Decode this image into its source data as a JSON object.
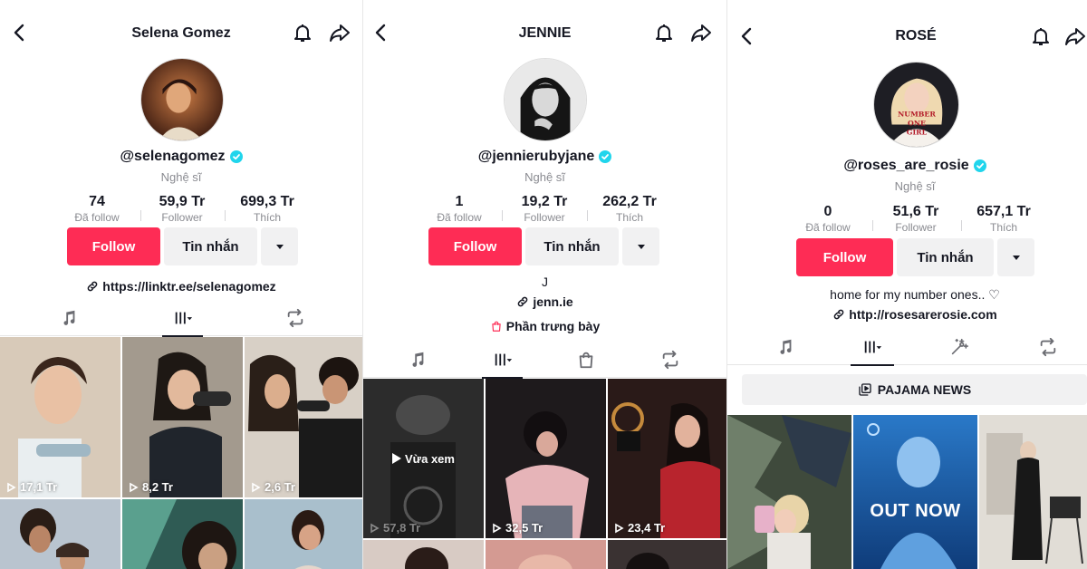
{
  "profiles": [
    {
      "name": "Selena Gomez",
      "handle": "@selenagomez",
      "subtitle": "Nghệ sĩ",
      "stats": [
        {
          "value": "74",
          "label": "Đã follow"
        },
        {
          "value": "59,9 Tr",
          "label": "Follower"
        },
        {
          "value": "699,3 Tr",
          "label": "Thích"
        }
      ],
      "follow_label": "Follow",
      "message_label": "Tin nhắn",
      "link": "https://linktr.ee/selenagomez",
      "videos": [
        {
          "views": "17,1 Tr",
          "color": "#c9b8a6"
        },
        {
          "views": "8,2 Tr",
          "color": "#8a8176"
        },
        {
          "views": "2,6 Tr",
          "color": "#6f6055"
        },
        {
          "views": "",
          "color": "#7b8aa0"
        },
        {
          "views": "",
          "color": "#3f6f66"
        },
        {
          "views": "",
          "color": "#8fa7b8"
        }
      ]
    },
    {
      "name": "JENNIE",
      "handle": "@jennierubyjane",
      "subtitle": "Nghệ sĩ",
      "stats": [
        {
          "value": "1",
          "label": "Đã follow"
        },
        {
          "value": "19,2 Tr",
          "label": "Follower"
        },
        {
          "value": "262,2 Tr",
          "label": "Thích"
        }
      ],
      "follow_label": "Follow",
      "message_label": "Tin nhắn",
      "bio": "J",
      "link": "jenn.ie",
      "showcase": "Phần trưng bày",
      "videos": [
        {
          "views": "57,8 Tr",
          "color": "#2a2a2a",
          "overlay": "Vừa xem"
        },
        {
          "views": "32,5 Tr",
          "color": "#3b2f33"
        },
        {
          "views": "23,4 Tr",
          "color": "#5a2226"
        },
        {
          "views": "",
          "color": "#b9a49a"
        },
        {
          "views": "",
          "color": "#c48a86"
        },
        {
          "views": "",
          "color": "#4b4040"
        }
      ]
    },
    {
      "name": "ROSÉ",
      "handle": "@roses_are_rosie",
      "subtitle": "Nghệ sĩ",
      "stats": [
        {
          "value": "0",
          "label": "Đã follow"
        },
        {
          "value": "51,6 Tr",
          "label": "Follower"
        },
        {
          "value": "657,1 Tr",
          "label": "Thích"
        }
      ],
      "follow_label": "Follow",
      "message_label": "Tin nhắn",
      "bio": "home for my number ones.. ♡",
      "link": "http://rosesarerosie.com",
      "playlist": "PAJAMA NEWS",
      "videos": [
        {
          "views": "",
          "color": "#5f6b5a"
        },
        {
          "views": "",
          "color": "#1f5fa8",
          "big": "OUT NOW"
        },
        {
          "views": "",
          "color": "#d6d2cc"
        }
      ]
    }
  ],
  "colors": {
    "accent": "#fe2c55",
    "verified": "#20d5ec"
  }
}
